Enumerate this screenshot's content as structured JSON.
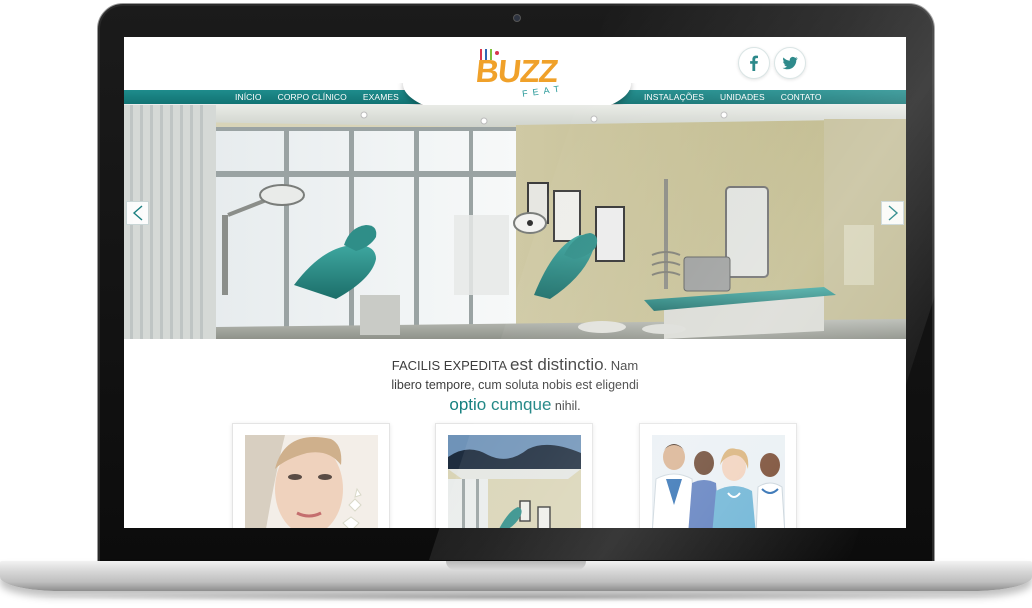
{
  "site": {
    "logo_text": "BUZZ",
    "logo_sub": "FEAT",
    "logo_colors": [
      "#d9364f",
      "#2f66b3",
      "#7fbf3a",
      "#f0a12a"
    ]
  },
  "nav": {
    "left": [
      {
        "label": "INÍCIO"
      },
      {
        "label": "CORPO CLÍNICO"
      },
      {
        "label": "EXAMES"
      }
    ],
    "right": [
      {
        "label": "INSTALAÇÕES"
      },
      {
        "label": "UNIDADES"
      },
      {
        "label": "CONTATO"
      }
    ]
  },
  "social": [
    {
      "icon": "facebook-icon",
      "glyph": "f"
    },
    {
      "icon": "twitter-icon"
    }
  ],
  "slider": {
    "prev_icon": "chevron-left-icon",
    "next_icon": "chevron-right-icon"
  },
  "intro": {
    "line1_a": "FACILIS EXPEDITA",
    "line1_b": "est distinctio",
    "line1_c": ". Nam",
    "line2": "libero tempore, cum soluta nobis est eligendi",
    "line3_a": "optio cumque",
    "line3_b": "nihil."
  },
  "colors": {
    "teal": "#15807f",
    "nav": "#1a8282",
    "logo_orange": "#f0a12a"
  }
}
